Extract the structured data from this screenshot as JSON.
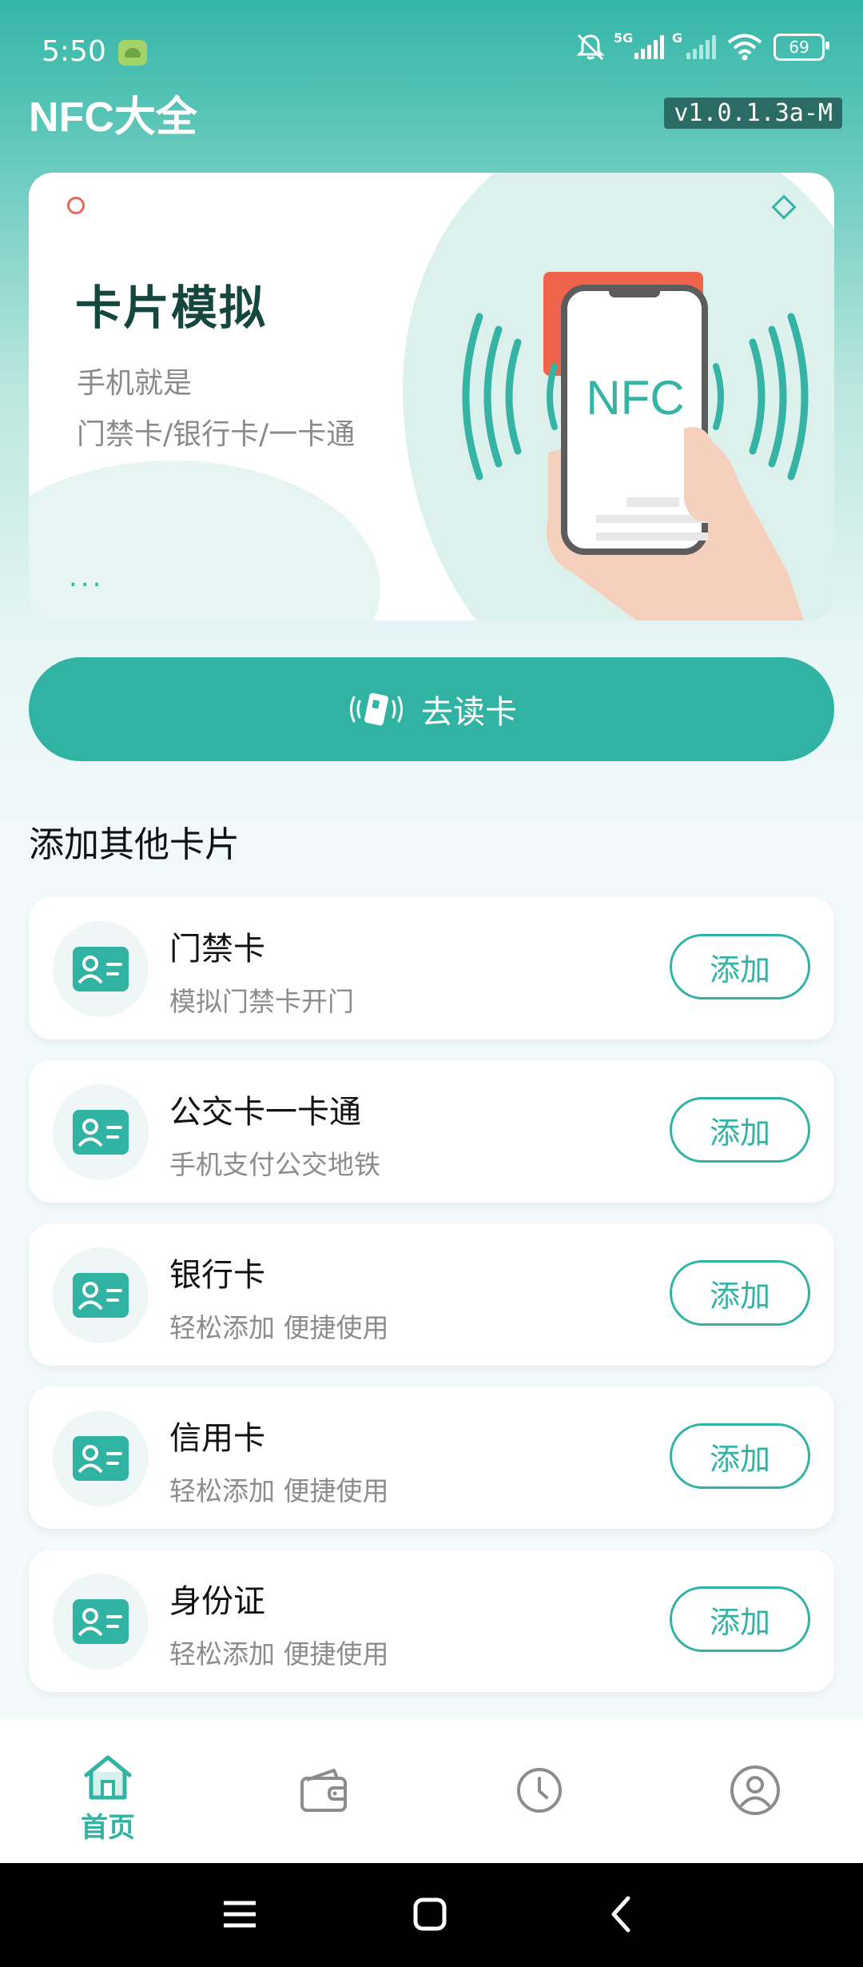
{
  "status_bar": {
    "time": "5:50",
    "signal1": "5G",
    "signal2": "G",
    "battery": "69"
  },
  "app": {
    "title": "NFC大全",
    "version": "v1.0.1.3a-M"
  },
  "banner": {
    "title": "卡片模拟",
    "subtitle_line1": "手机就是",
    "subtitle_line2": "门禁卡/银行卡/一卡通",
    "ellipsis": "...",
    "nfc_text": "NFC"
  },
  "read_button": {
    "label": "去读卡"
  },
  "section": {
    "title": "添加其他卡片"
  },
  "cards": [
    {
      "title": "门禁卡",
      "subtitle": "模拟门禁卡开门",
      "button": "添加"
    },
    {
      "title": "公交卡一卡通",
      "subtitle": "手机支付公交地铁",
      "button": "添加"
    },
    {
      "title": "银行卡",
      "subtitle": "轻松添加 便捷使用",
      "button": "添加"
    },
    {
      "title": "信用卡",
      "subtitle": "轻松添加 便捷使用",
      "button": "添加"
    },
    {
      "title": "身份证",
      "subtitle": "轻松添加 便捷使用",
      "button": "添加"
    }
  ],
  "bottom_nav": {
    "home_label": "首页",
    "active": "home",
    "icons": [
      "home-icon",
      "wallet-icon",
      "clock-icon",
      "profile-icon"
    ]
  },
  "colors": {
    "accent": "#31b3a4",
    "header_bg": "#34b6a8",
    "nfc_red": "#f0644c"
  }
}
